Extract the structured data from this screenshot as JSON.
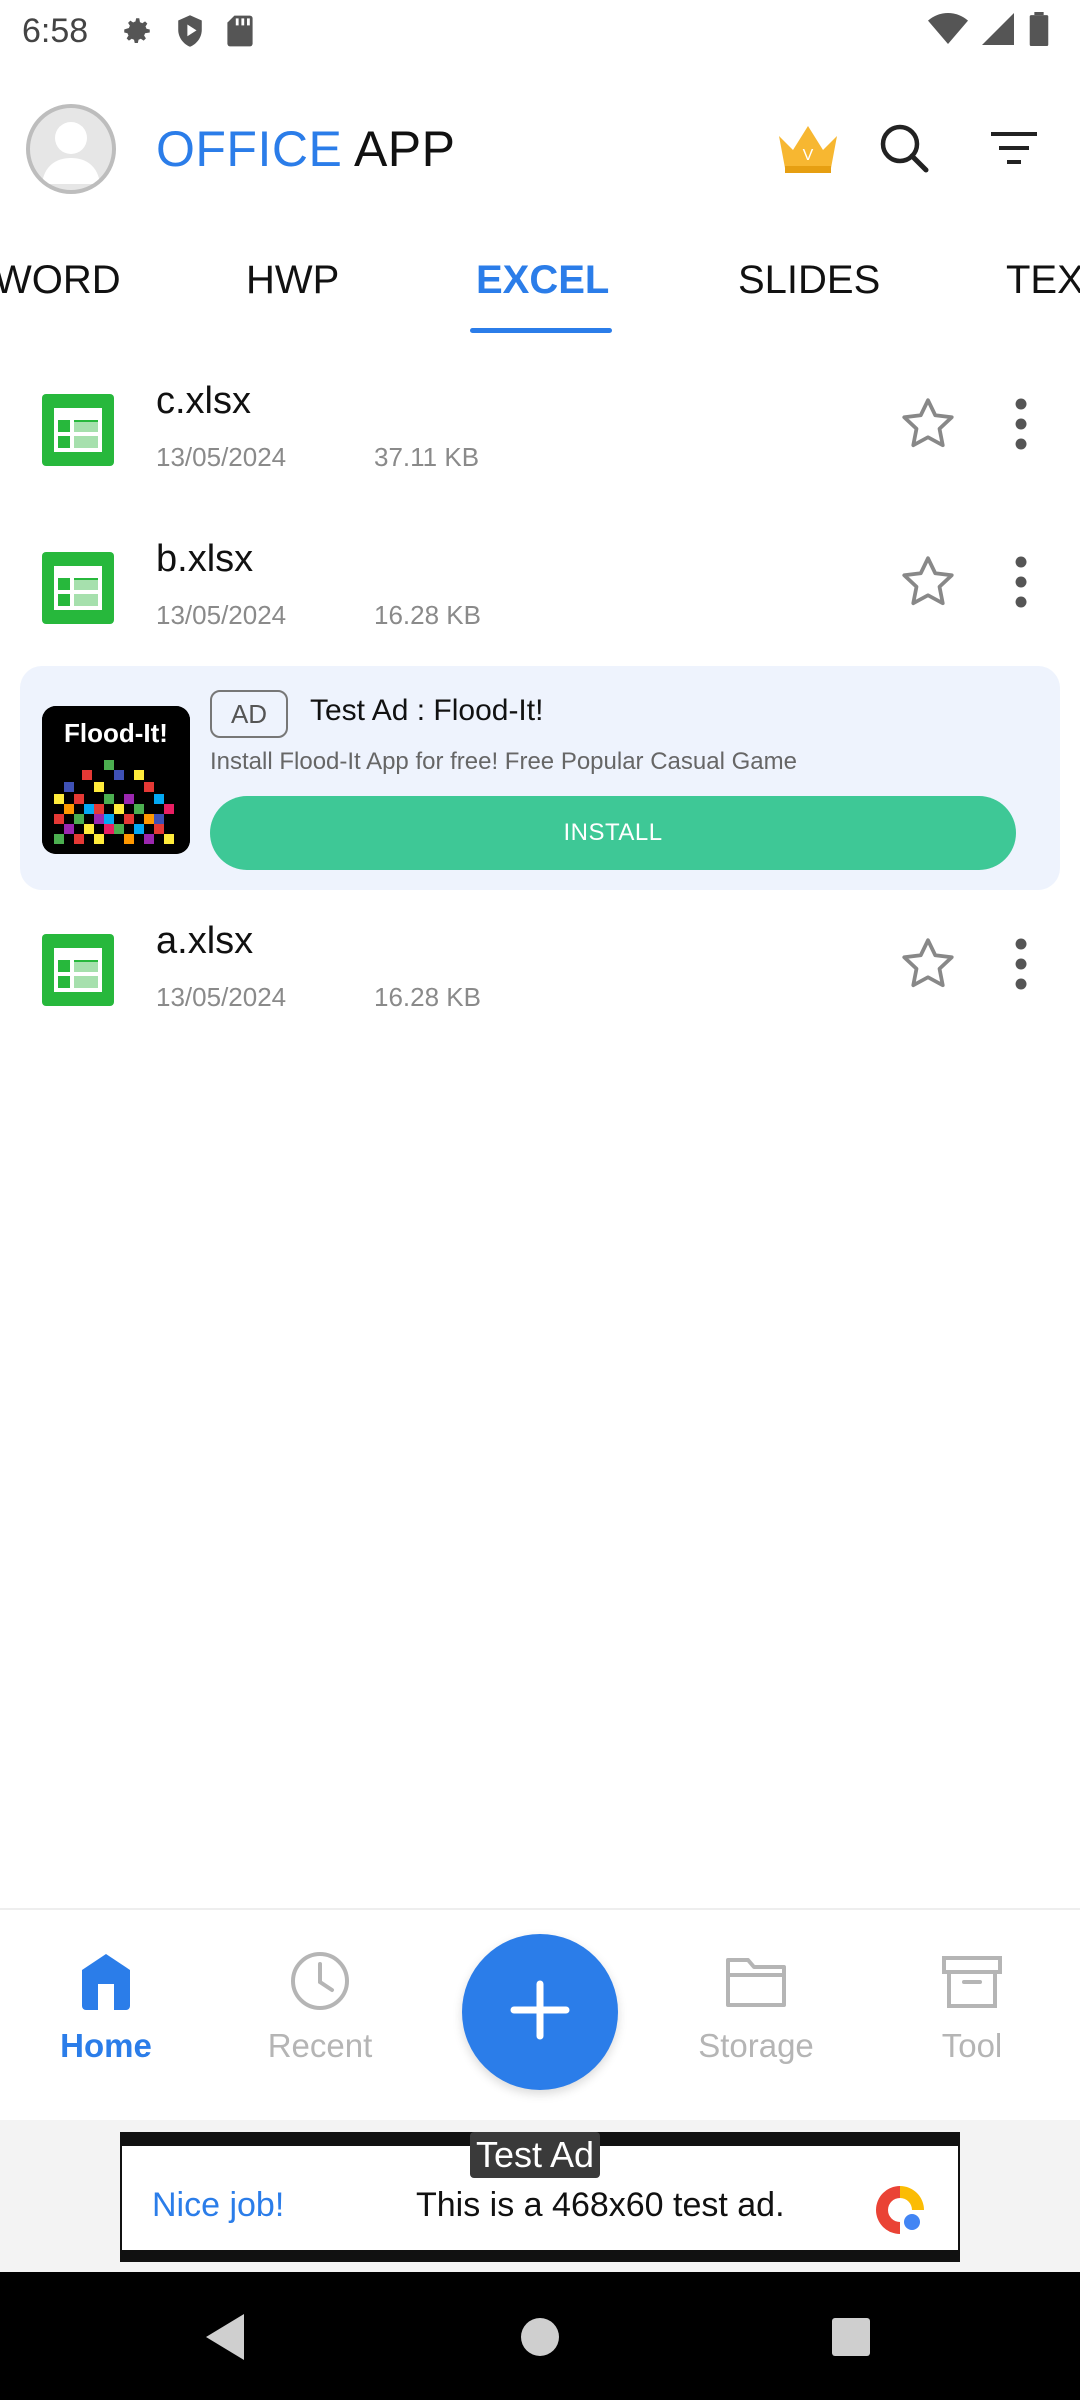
{
  "status_bar": {
    "time": "6:58",
    "icons_left": [
      "gear-icon",
      "shield-play-icon",
      "sd-card-icon"
    ],
    "icons_right": [
      "wifi-icon",
      "signal-icon",
      "battery-icon"
    ]
  },
  "header": {
    "brand": "OFFICE",
    "title_rest": " APP",
    "icons": [
      "avatar",
      "crown-icon",
      "search-icon",
      "filter-icon"
    ]
  },
  "tabs": [
    {
      "label": "WORD"
    },
    {
      "label": "HWP"
    },
    {
      "label": "EXCEL",
      "active": true
    },
    {
      "label": "SLIDES"
    },
    {
      "label": "TEX"
    }
  ],
  "files": [
    {
      "name": "c.xlsx",
      "date": "13/05/2024",
      "size": "37.11 KB"
    },
    {
      "name": "b.xlsx",
      "date": "13/05/2024",
      "size": "16.28 KB"
    },
    {
      "name": "a.xlsx",
      "date": "13/05/2024",
      "size": "16.28 KB"
    }
  ],
  "ad": {
    "badge": "AD",
    "title": "Test Ad : Flood-It!",
    "description": "Install Flood-It App for free! Free Popular Casual Game",
    "install_label": "INSTALL",
    "image_text": "Flood-It!"
  },
  "bottom_nav": {
    "items": [
      {
        "label": "Home",
        "active": true
      },
      {
        "label": "Recent"
      },
      {
        "label": "Storage"
      },
      {
        "label": "Tool"
      }
    ]
  },
  "banner": {
    "tag": "Test Ad",
    "cta": "Nice job!",
    "text": "This is a 468x60 test ad."
  },
  "colors": {
    "accent": "#2b7de9",
    "excel_green": "#27b83c",
    "install_green": "#3ec896",
    "ad_bg": "#eef3fd"
  }
}
